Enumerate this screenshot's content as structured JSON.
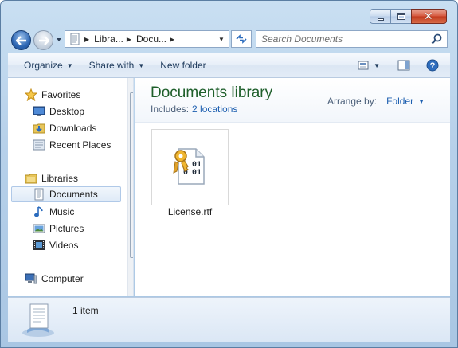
{
  "address": {
    "segments": [
      "Libra...",
      "Docu..."
    ]
  },
  "search": {
    "placeholder": "Search Documents"
  },
  "toolbar": {
    "organize": "Organize",
    "share_with": "Share with",
    "new_folder": "New folder"
  },
  "nav": {
    "favorites": "Favorites",
    "desktop": "Desktop",
    "downloads": "Downloads",
    "recent": "Recent Places",
    "libraries": "Libraries",
    "documents": "Documents",
    "music": "Music",
    "pictures": "Pictures",
    "videos": "Videos",
    "computer": "Computer"
  },
  "library": {
    "title": "Documents library",
    "includes_label": "Includes:",
    "locations_link": "2 locations",
    "arrange_label": "Arrange by:",
    "arrange_value": "Folder"
  },
  "files": [
    {
      "name": "License.rtf",
      "icon": "rtf-document-icon"
    }
  ],
  "status": {
    "item_count": "1 item"
  },
  "colors": {
    "accent": "#1d5fb0",
    "library_title": "#1e5f2a",
    "close_button": "#c23b1f"
  }
}
